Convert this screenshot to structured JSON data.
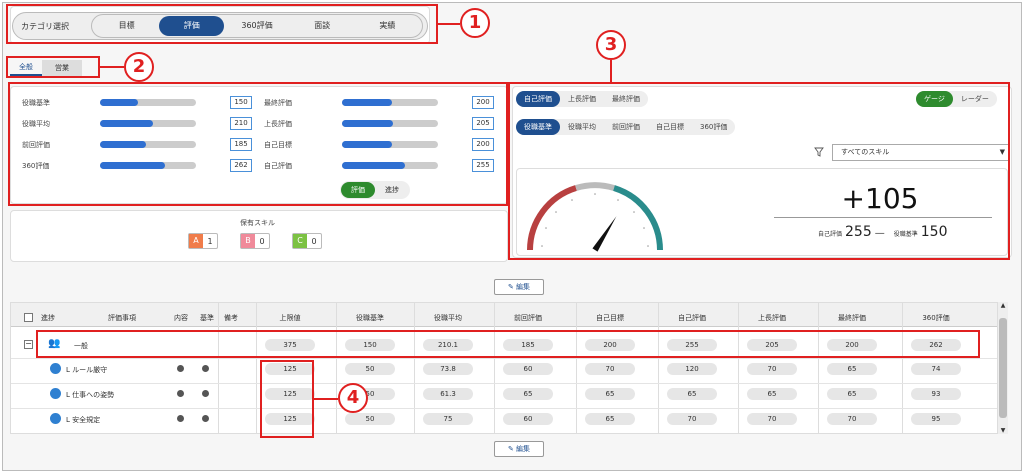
{
  "category": {
    "label": "カテゴリ選択",
    "tabs": [
      "目標",
      "評価",
      "360評価",
      "面談",
      "実績"
    ],
    "active_index": 1
  },
  "dept_tabs": [
    "全般",
    "営業"
  ],
  "scores_left": [
    {
      "label": "役職基準",
      "value": "150",
      "level": 0.4
    },
    {
      "label": "役職平均",
      "value": "210",
      "level": 0.55
    },
    {
      "label": "前回評価",
      "value": "185",
      "level": 0.48
    },
    {
      "label": "360評価",
      "value": "262",
      "level": 0.68
    }
  ],
  "scores_right": [
    {
      "label": "最終評価",
      "value": "200",
      "level": 0.52
    },
    {
      "label": "上長評価",
      "value": "205",
      "level": 0.53
    },
    {
      "label": "自己目標",
      "value": "200",
      "level": 0.52
    },
    {
      "label": "自己評価",
      "value": "255",
      "level": 0.66
    }
  ],
  "score_toggle": [
    "評価",
    "進捗"
  ],
  "skills": {
    "title": "保有スキル",
    "items": [
      {
        "letter": "A",
        "count": "1",
        "color": "#f07c4a"
      },
      {
        "letter": "B",
        "count": "0",
        "color": "#f08a9a"
      },
      {
        "letter": "C",
        "count": "0",
        "color": "#7cc243"
      }
    ]
  },
  "compare_tabs_1": [
    "自己評価",
    "上長評価",
    "最終評価"
  ],
  "compare_tabs_2": [
    "役職基準",
    "役職平均",
    "前回評価",
    "自己目標",
    "360評価"
  ],
  "view_toggle": [
    "ゲージ",
    "レーダー"
  ],
  "skill_filter": "すべてのスキル",
  "gauge": {
    "diff": "+105",
    "left_label": "自己評価",
    "left_value": "255",
    "dash": "—",
    "right_label": "役職基準",
    "right_value": "150",
    "needle_fraction": 0.68
  },
  "edit_label": "編集",
  "table": {
    "headers": [
      "進捗",
      "評価事項",
      "内容",
      "基準",
      "備考",
      "上限値",
      "役職基準",
      "役職平均",
      "前回評価",
      "自己目標",
      "自己評価",
      "上長評価",
      "最終評価",
      "360評価"
    ],
    "group": {
      "label": "一般",
      "values": [
        "375",
        "150",
        "210.1",
        "185",
        "200",
        "255",
        "205",
        "200",
        "262"
      ]
    },
    "rows": [
      {
        "label": "L ルール厳守",
        "values": [
          "125",
          "50",
          "73.8",
          "60",
          "70",
          "120",
          "70",
          "65",
          "74"
        ]
      },
      {
        "label": "L 仕事への姿勢",
        "values": [
          "125",
          "50",
          "61.3",
          "65",
          "65",
          "65",
          "65",
          "65",
          "93"
        ]
      },
      {
        "label": "L 安全規定",
        "values": [
          "125",
          "50",
          "75",
          "60",
          "65",
          "70",
          "70",
          "70",
          "95"
        ]
      }
    ]
  },
  "callouts": [
    "1",
    "2",
    "3",
    "4"
  ]
}
